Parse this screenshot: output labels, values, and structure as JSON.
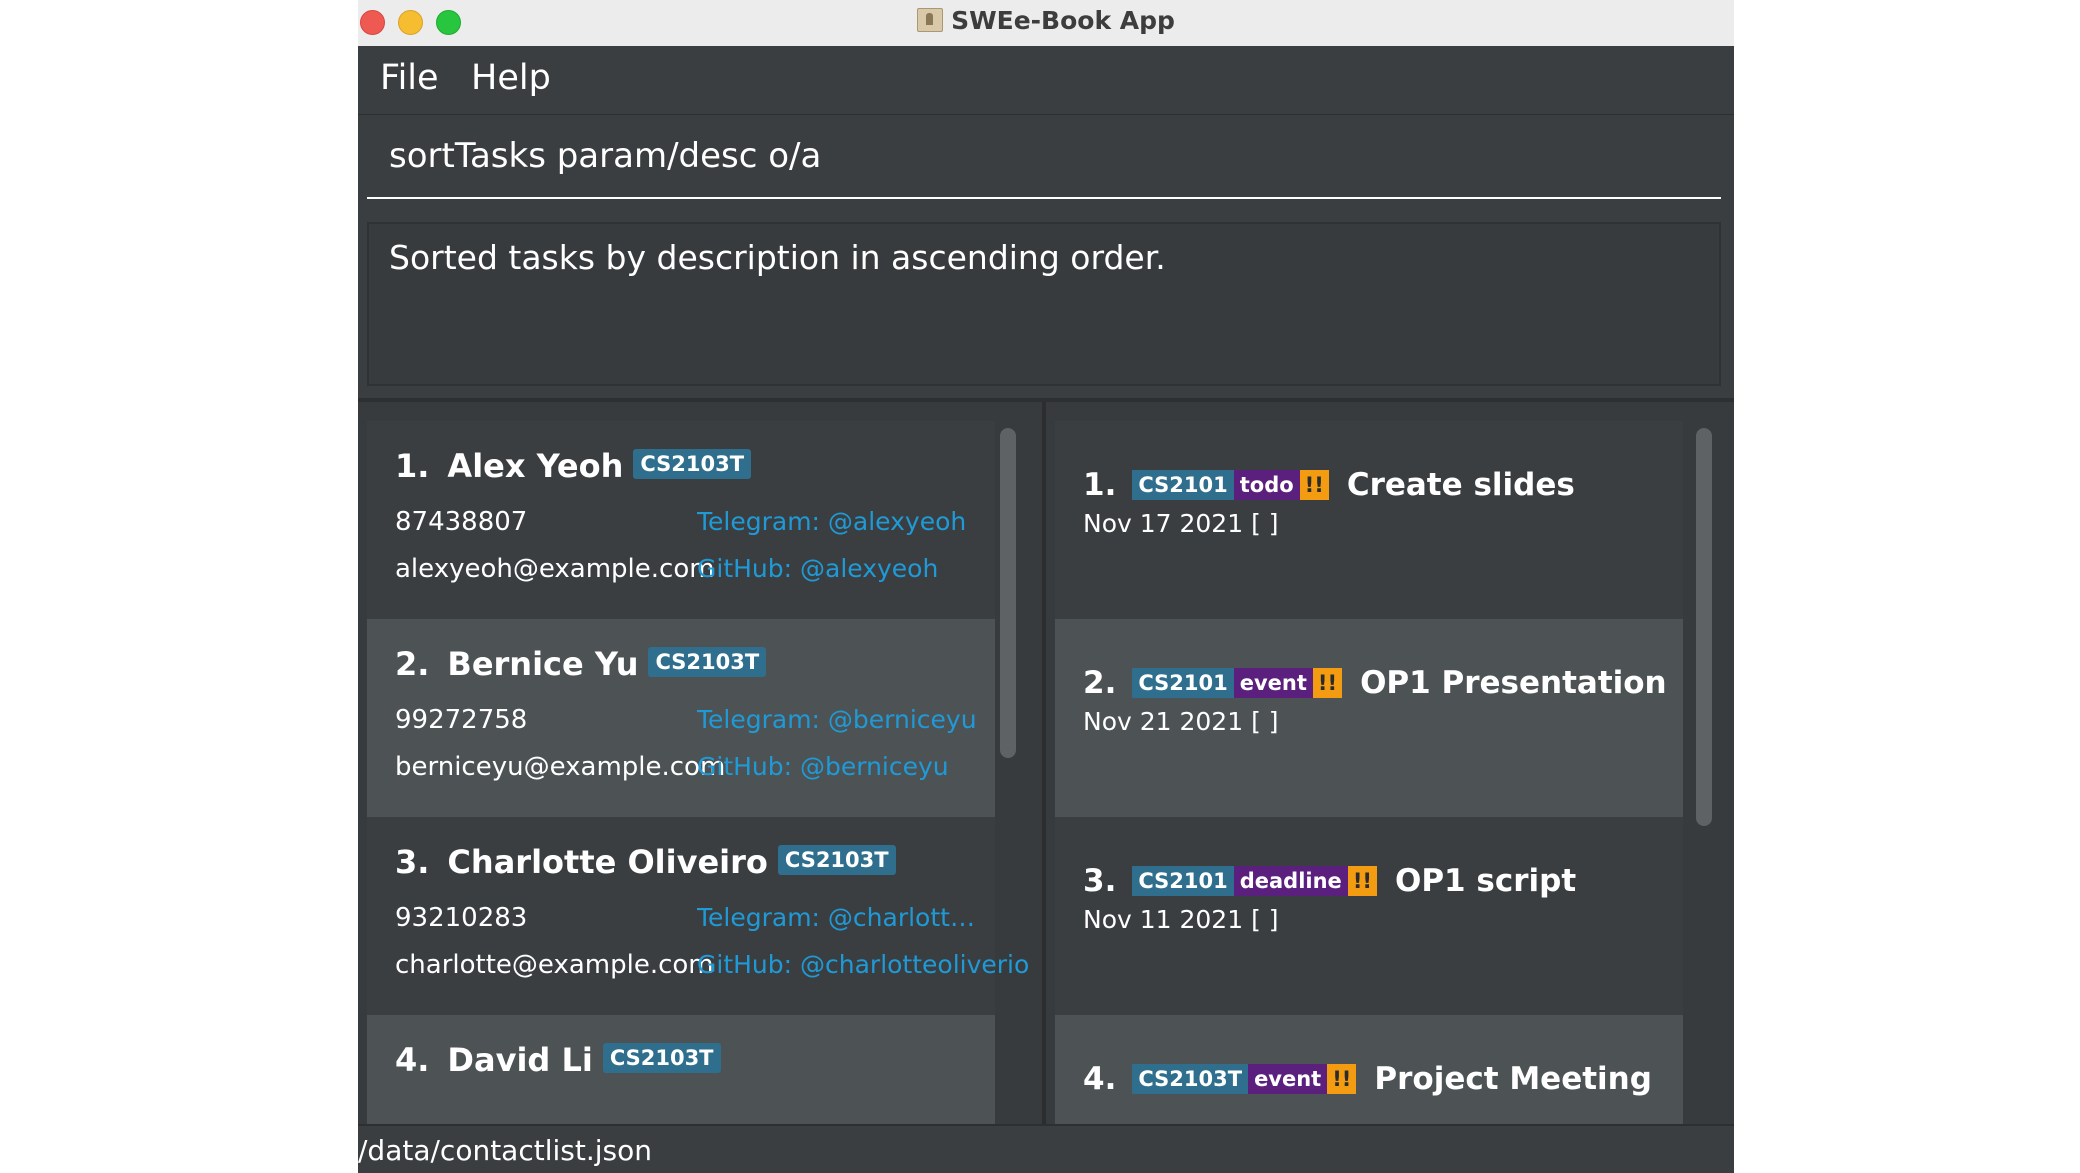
{
  "window": {
    "title": "SWEe-Book App"
  },
  "menu": {
    "file": "File",
    "help": "Help"
  },
  "command": {
    "value": "sortTasks param/desc o/a"
  },
  "result": {
    "message": "Sorted tasks by description in ascending order."
  },
  "contacts": [
    {
      "index": "1.",
      "name": "Alex Yeoh",
      "tag": "CS2103T",
      "phone": "87438807",
      "email": "alexyeoh@example.com",
      "telegram": "Telegram: @alexyeoh",
      "github": "GitHub: @alexyeoh"
    },
    {
      "index": "2.",
      "name": "Bernice Yu",
      "tag": "CS2103T",
      "phone": "99272758",
      "email": "berniceyu@example.com",
      "telegram": "Telegram: @berniceyu",
      "github": "GitHub: @berniceyu"
    },
    {
      "index": "3.",
      "name": "Charlotte Oliveiro",
      "tag": "CS2103T",
      "phone": "93210283",
      "email": "charlotte@example.com",
      "telegram": "Telegram: @charlotteoliv...",
      "github": "GitHub: @charlotteoliverio"
    },
    {
      "index": "4.",
      "name": "David Li",
      "tag": "CS2103T"
    }
  ],
  "tasks": [
    {
      "index": "1.",
      "module": "CS2101",
      "type": "todo",
      "priority": "!!",
      "description": "Create slides",
      "date": "Nov 17 2021 [ ]"
    },
    {
      "index": "2.",
      "module": "CS2101",
      "type": "event",
      "priority": "!!",
      "description": "OP1 Presentation",
      "date": "Nov 21 2021 [ ]"
    },
    {
      "index": "3.",
      "module": "CS2101",
      "type": "deadline",
      "priority": "!!",
      "description": "OP1 script",
      "date": "Nov 11 2021 [ ]"
    },
    {
      "index": "4.",
      "module": "CS2103T",
      "type": "event",
      "priority": "!!",
      "description": "Project Meeting"
    }
  ],
  "status": {
    "path": "/data/contactlist.json"
  },
  "colors": {
    "background": "#3b3e40",
    "card_dark": "#3a3e41",
    "card_light": "#4d5255",
    "tag": "#2f6f8d",
    "type_chip": "#5b1f7e",
    "priority_chip": "#f39c12",
    "link": "#1f9ad6"
  }
}
